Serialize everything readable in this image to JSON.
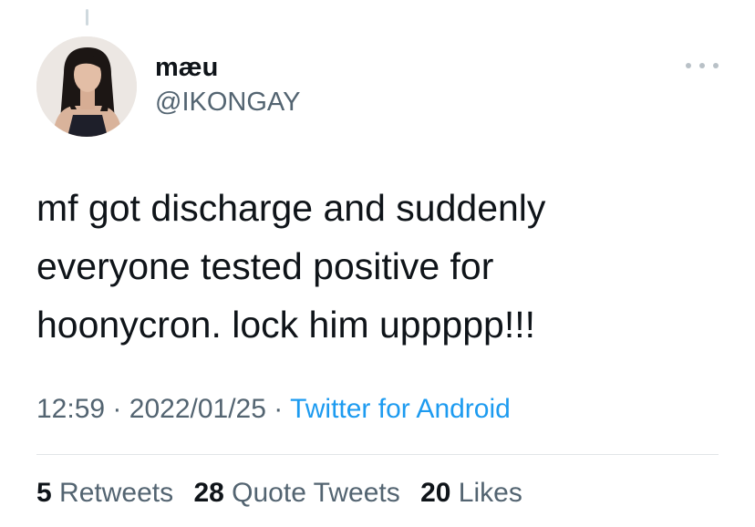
{
  "tweet": {
    "author": {
      "display_name": "mæu",
      "handle": "@IKONGAY"
    },
    "text_lines": [
      "mf got discharge and suddenly",
      "everyone tested positive for",
      "hoonycron. lock him uppppp!!!"
    ],
    "time": "12:59",
    "date": "2022/01/25",
    "separator": "·",
    "source": "Twitter for Android",
    "stats": {
      "retweets": {
        "count": "5",
        "label": "Retweets"
      },
      "quote_tweets": {
        "count": "28",
        "label": "Quote Tweets"
      },
      "likes": {
        "count": "20",
        "label": "Likes"
      }
    }
  },
  "icons": {
    "more": "more-horizontal-icon"
  },
  "colors": {
    "text_primary": "#0f1419",
    "text_secondary": "#536471",
    "link": "#1d9bf0",
    "divider": "#e1e5e8",
    "background": "#ffffff"
  }
}
